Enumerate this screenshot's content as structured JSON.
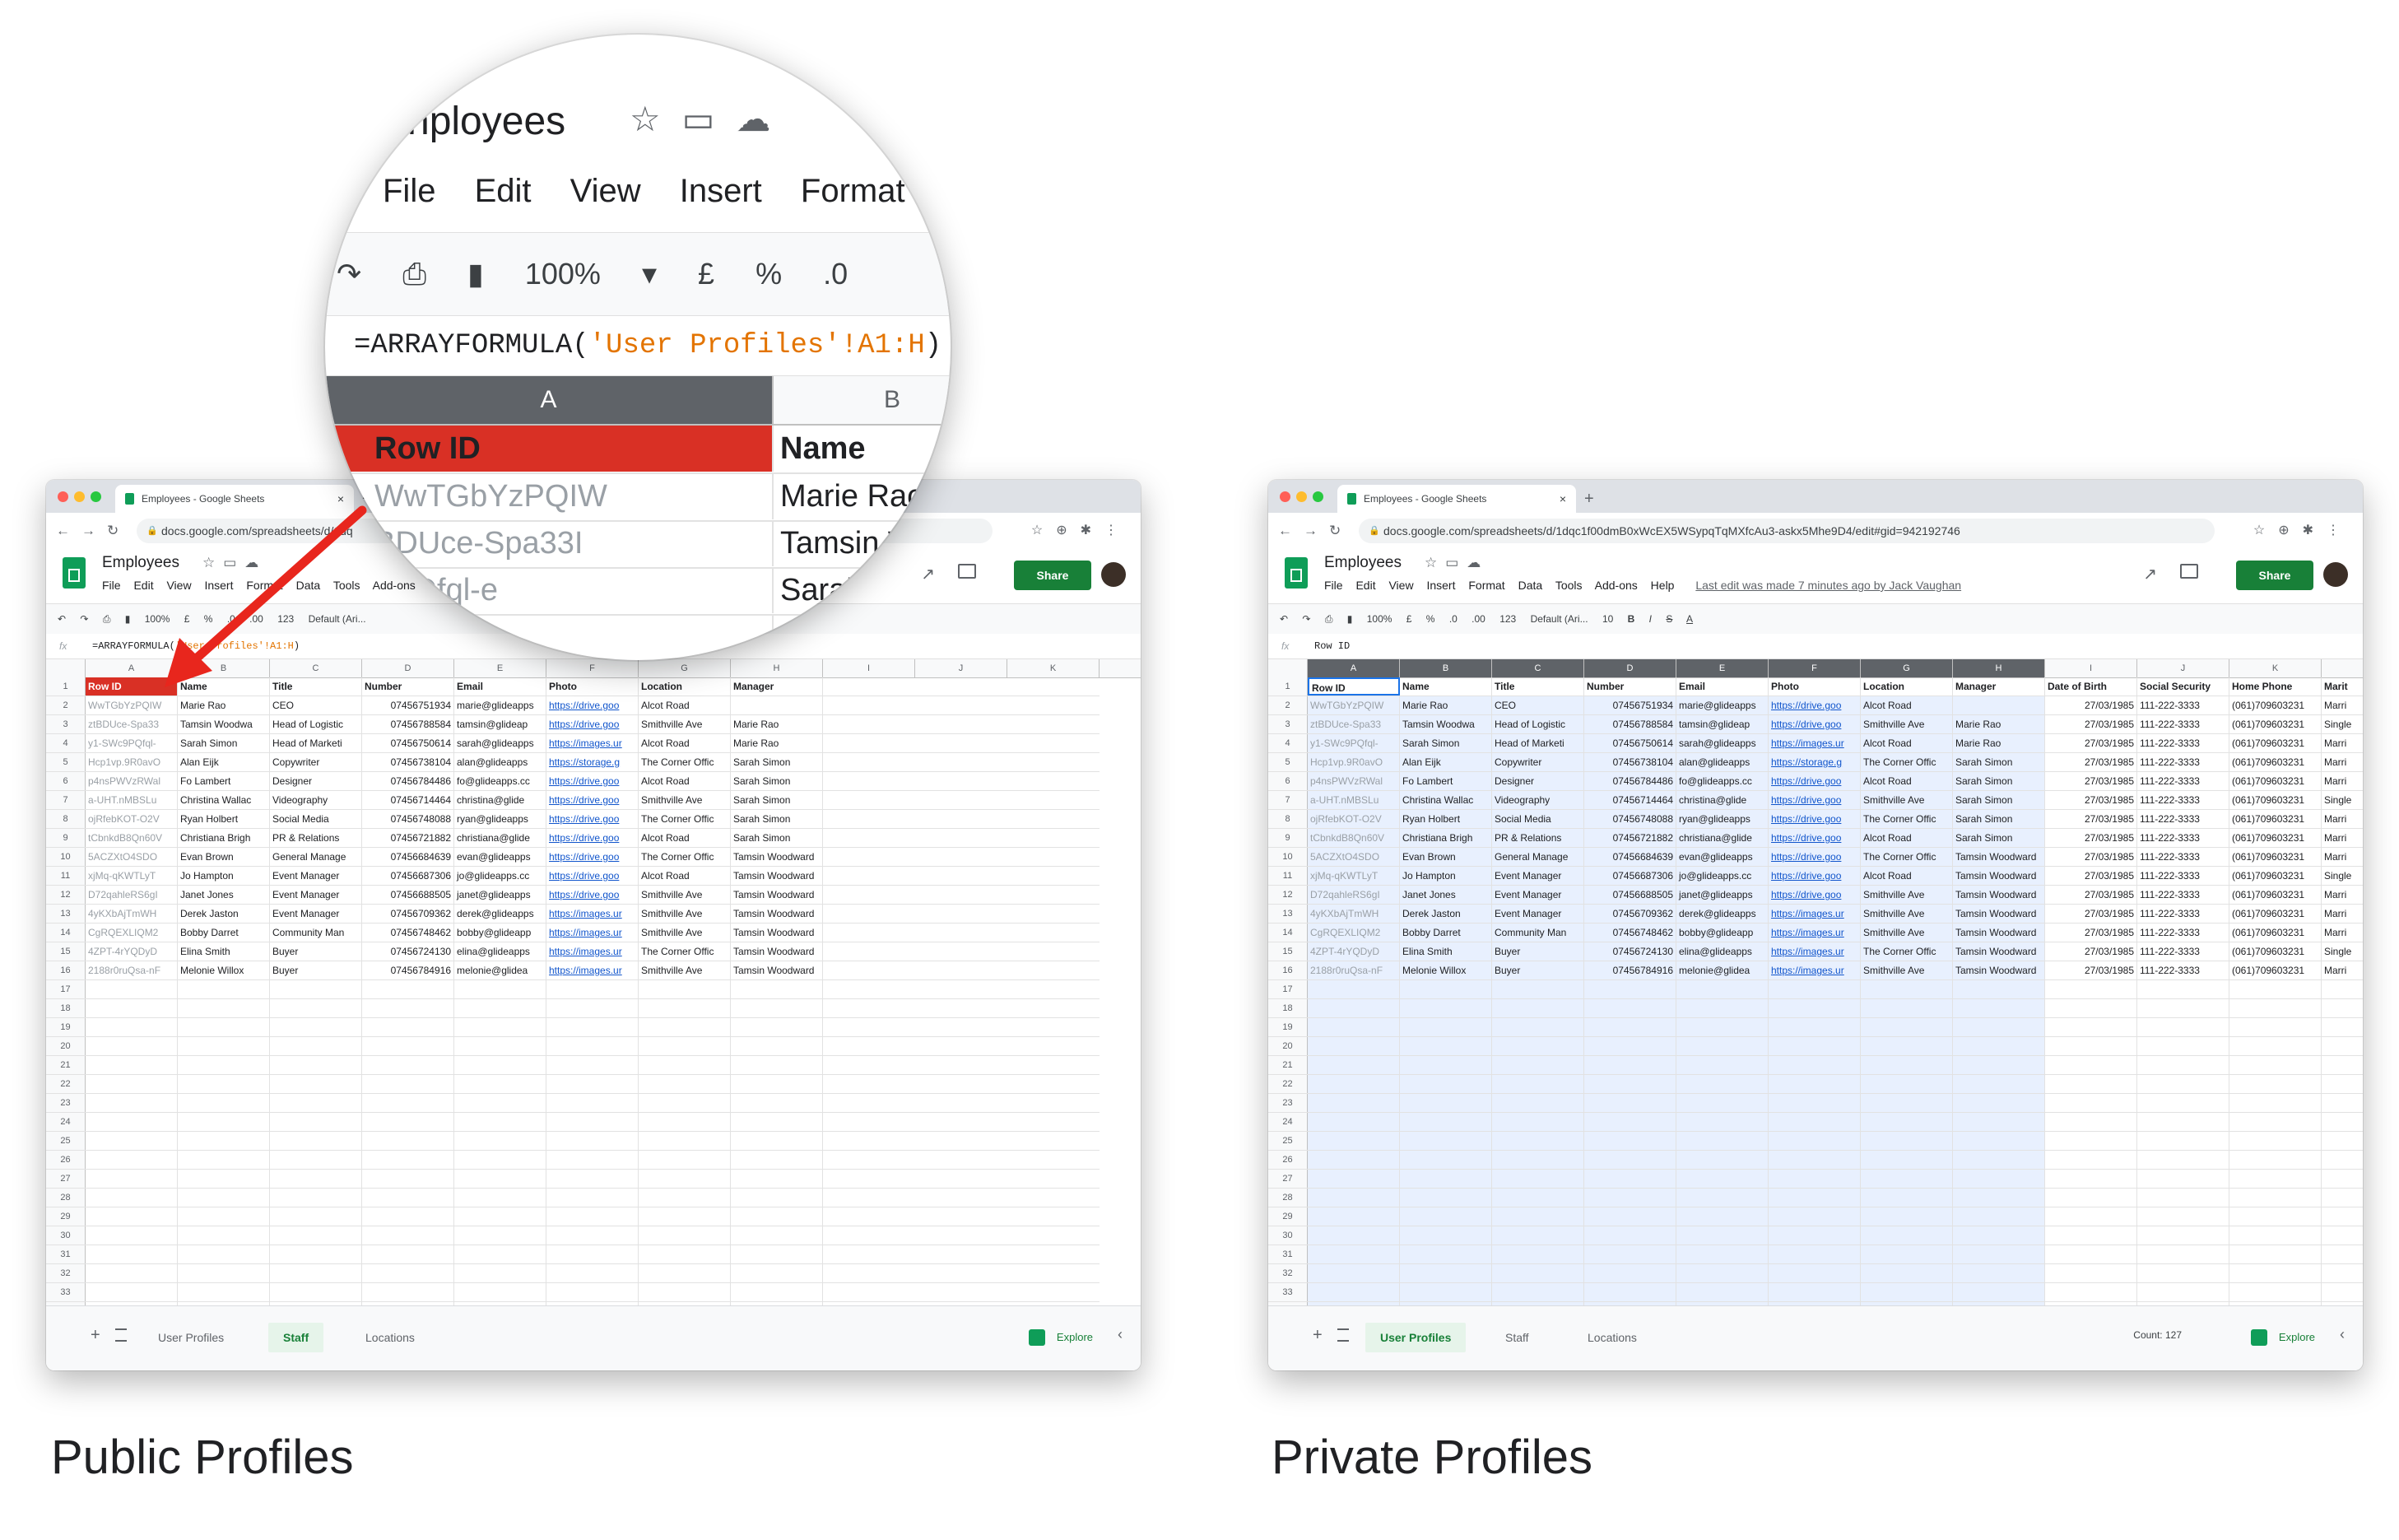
{
  "captions": {
    "left": "Public Profiles",
    "right": "Private Profiles"
  },
  "colors": {
    "accent_green": "#188038",
    "row_id_header_red": "#d93025",
    "arrow_red": "#e8261d",
    "link_blue": "#1155cc",
    "selection_blue": "#e8f0fe"
  },
  "public": {
    "tab_title": "Employees - Google Sheets",
    "url": "docs.google.com/spreadsheets/d/1dq",
    "doc_title": "Employees",
    "menu": [
      "File",
      "Edit",
      "View",
      "Insert",
      "Format",
      "Data",
      "Tools",
      "Add-ons"
    ],
    "share_label": "Share",
    "toolbar": {
      "zoom": "100%",
      "currency": "£",
      "percent": "%",
      "dec_less": ".0",
      "dec_more": ".00",
      "more_formats": "123",
      "font": "Default (Ari..."
    },
    "formula_prefix": "=ARRAYFORMULA(",
    "formula_string": "'User Profiles'!A1:H",
    "formula_suffix": ")",
    "columns": [
      "A",
      "B",
      "C",
      "D",
      "E",
      "F",
      "G",
      "H",
      "I",
      "J",
      "K"
    ],
    "headers": [
      "Row ID",
      "Name",
      "Title",
      "Number",
      "Email",
      "Photo",
      "Location",
      "Manager"
    ],
    "sheet_tabs": [
      "User Profiles",
      "Staff",
      "Locations"
    ],
    "active_tab": "Staff",
    "explore_label": "Explore"
  },
  "private": {
    "tab_title": "Employees - Google Sheets",
    "url": "docs.google.com/spreadsheets/d/1dqc1f00dmB0xWcEX5WSypqTqMXfcAu3-askx5Mhe9D4/edit#gid=942192746",
    "doc_title": "Employees",
    "menu": [
      "File",
      "Edit",
      "View",
      "Insert",
      "Format",
      "Data",
      "Tools",
      "Add-ons",
      "Help"
    ],
    "last_edit": "Last edit was made 7 minutes ago by Jack Vaughan",
    "share_label": "Share",
    "toolbar": {
      "zoom": "100%",
      "currency": "£",
      "percent": "%",
      "dec_less": ".0",
      "dec_more": ".00",
      "more_formats": "123",
      "font": "Default (Ari...",
      "size": "10"
    },
    "formula_value": "Row ID",
    "columns": [
      "A",
      "B",
      "C",
      "D",
      "E",
      "F",
      "G",
      "H",
      "I",
      "J",
      "K",
      "L"
    ],
    "headers": [
      "Row ID",
      "Name",
      "Title",
      "Number",
      "Email",
      "Photo",
      "Location",
      "Manager",
      "Date of Birth",
      "Social Security",
      "Home Phone",
      "Marit"
    ],
    "sheet_tabs": [
      "User Profiles",
      "Staff",
      "Locations"
    ],
    "active_tab": "User Profiles",
    "count": "Count: 127",
    "explore_label": "Explore"
  },
  "rows": [
    {
      "id": "WwTGbYzPQIW",
      "name": "Marie Rao",
      "title": "CEO",
      "number": "07456751934",
      "email": "marie@glideapps",
      "photo": "https://drive.goo",
      "location": "Alcot Road",
      "manager": "",
      "dob": "27/03/1985",
      "ssn": "111-222-3333",
      "phone": "(061)709603231",
      "marital": "Marri"
    },
    {
      "id": "ztBDUce-Spa33",
      "name": "Tamsin Woodwa",
      "title": "Head of Logistic",
      "number": "07456788584",
      "email": "tamsin@glideap",
      "photo": "https://drive.goo",
      "location": "Smithville Ave",
      "manager": "Marie Rao",
      "dob": "27/03/1985",
      "ssn": "111-222-3333",
      "phone": "(061)709603231",
      "marital": "Single"
    },
    {
      "id": "y1-SWc9PQfql-",
      "name": "Sarah Simon",
      "title": "Head of Marketi",
      "number": "07456750614",
      "email": "sarah@glideapps",
      "photo": "https://images.ur",
      "location": "Alcot Road",
      "manager": "Marie Rao",
      "dob": "27/03/1985",
      "ssn": "111-222-3333",
      "phone": "(061)709603231",
      "marital": "Marri"
    },
    {
      "id": "Hcp1vp.9R0avO",
      "name": "Alan Eijk",
      "title": "Copywriter",
      "number": "07456738104",
      "email": "alan@glideapps",
      "photo": "https://storage.g",
      "location": "The Corner Offic",
      "manager": "Sarah Simon",
      "dob": "27/03/1985",
      "ssn": "111-222-3333",
      "phone": "(061)709603231",
      "marital": "Marri"
    },
    {
      "id": "p4nsPWVzRWal",
      "name": "Fo Lambert",
      "title": "Designer",
      "number": "07456784486",
      "email": "fo@glideapps.cc",
      "photo": "https://drive.goo",
      "location": "Alcot Road",
      "manager": "Sarah Simon",
      "dob": "27/03/1985",
      "ssn": "111-222-3333",
      "phone": "(061)709603231",
      "marital": "Marri"
    },
    {
      "id": "a-UHT.nMBSLu",
      "name": "Christina Wallac",
      "title": "Videography",
      "number": "07456714464",
      "email": "christina@glide",
      "photo": "https://drive.goo",
      "location": "Smithville Ave",
      "manager": "Sarah Simon",
      "dob": "27/03/1985",
      "ssn": "111-222-3333",
      "phone": "(061)709603231",
      "marital": "Single"
    },
    {
      "id": "ojRfebKOT-O2V",
      "name": "Ryan Holbert",
      "title": "Social Media",
      "number": "07456748088",
      "email": "ryan@glideapps",
      "photo": "https://drive.goo",
      "location": "The Corner Offic",
      "manager": "Sarah Simon",
      "dob": "27/03/1985",
      "ssn": "111-222-3333",
      "phone": "(061)709603231",
      "marital": "Marri"
    },
    {
      "id": "tCbnkdB8Qn60V",
      "name": "Christiana Brigh",
      "title": "PR & Relations",
      "number": "07456721882",
      "email": "christiana@glide",
      "photo": "https://drive.goo",
      "location": "Alcot Road",
      "manager": "Sarah Simon",
      "dob": "27/03/1985",
      "ssn": "111-222-3333",
      "phone": "(061)709603231",
      "marital": "Marri"
    },
    {
      "id": "5ACZXtO4SDO",
      "name": "Evan Brown",
      "title": "General Manage",
      "number": "07456684639",
      "email": "evan@glideapps",
      "photo": "https://drive.goo",
      "location": "The Corner Offic",
      "manager": "Tamsin Woodward",
      "dob": "27/03/1985",
      "ssn": "111-222-3333",
      "phone": "(061)709603231",
      "marital": "Marri"
    },
    {
      "id": "xjMq-qKWTLyT",
      "name": "Jo Hampton",
      "title": "Event Manager",
      "number": "07456687306",
      "email": "jo@glideapps.cc",
      "photo": "https://drive.goo",
      "location": "Alcot Road",
      "manager": "Tamsin Woodward",
      "dob": "27/03/1985",
      "ssn": "111-222-3333",
      "phone": "(061)709603231",
      "marital": "Single"
    },
    {
      "id": "D72qahleRS6gI",
      "name": "Janet Jones",
      "title": "Event Manager",
      "number": "07456688505",
      "email": "janet@glideapps",
      "photo": "https://drive.goo",
      "location": "Smithville Ave",
      "manager": "Tamsin Woodward",
      "dob": "27/03/1985",
      "ssn": "111-222-3333",
      "phone": "(061)709603231",
      "marital": "Marri"
    },
    {
      "id": "4yKXbAjTmWH",
      "name": "Derek Jaston",
      "title": "Event Manager",
      "number": "07456709362",
      "email": "derek@glideapps",
      "photo": "https://images.ur",
      "location": "Smithville Ave",
      "manager": "Tamsin Woodward",
      "dob": "27/03/1985",
      "ssn": "111-222-3333",
      "phone": "(061)709603231",
      "marital": "Marri"
    },
    {
      "id": "CgRQEXLIQM2",
      "name": "Bobby Darret",
      "title": "Community Man",
      "number": "07456748462",
      "email": "bobby@glideapp",
      "photo": "https://images.ur",
      "location": "Smithville Ave",
      "manager": "Tamsin Woodward",
      "dob": "27/03/1985",
      "ssn": "111-222-3333",
      "phone": "(061)709603231",
      "marital": "Marri"
    },
    {
      "id": "4ZPT-4rYQDyD",
      "name": "Elina Smith",
      "title": "Buyer",
      "number": "07456724130",
      "email": "elina@glideapps",
      "photo": "https://images.ur",
      "location": "The Corner Offic",
      "manager": "Tamsin Woodward",
      "dob": "27/03/1985",
      "ssn": "111-222-3333",
      "phone": "(061)709603231",
      "marital": "Single"
    },
    {
      "id": "2188r0ruQsa-nF",
      "name": "Melonie Willox",
      "title": "Buyer",
      "number": "07456784916",
      "email": "melonie@glidea",
      "photo": "https://images.ur",
      "location": "Smithville Ave",
      "manager": "Tamsin Woodward",
      "dob": "27/03/1985",
      "ssn": "111-222-3333",
      "phone": "(061)709603231",
      "marital": "Marri"
    }
  ],
  "magnifier": {
    "title": "nployees",
    "menu": [
      "File",
      "Edit",
      "View",
      "Insert",
      "Format"
    ],
    "zoom": "100%",
    "currency": "£",
    "percent": "%",
    "dec": ".0",
    "formula_prefix": "=ARRAYFORMULA(",
    "formula_string": "'User Profiles'!A1:H",
    "formula_suffix": ")",
    "columns": [
      "A",
      "B",
      "C"
    ],
    "headers": [
      "Row ID",
      "Name",
      "Title"
    ],
    "rows": [
      {
        "id": "WwTGbYzPQIW",
        "name": "Marie Rao",
        "title": "CEO"
      },
      {
        "id": "BDUce-Spa33I",
        "name": "Tamsin Woodwa",
        "title": "Head"
      },
      {
        "id": "9PQfql-e",
        "name": "Sarah Simon",
        "title": "H"
      },
      {
        "id": "",
        "name": "Alan Eijk",
        "title": ""
      }
    ]
  }
}
